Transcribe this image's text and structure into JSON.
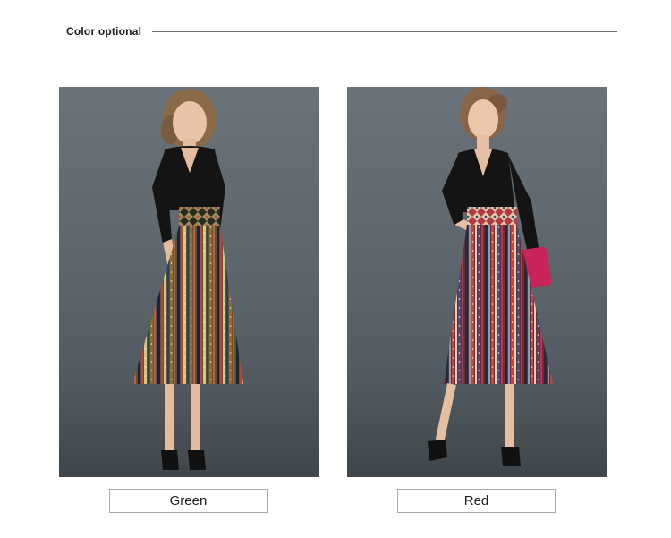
{
  "section": {
    "title": "Color optional"
  },
  "options": [
    {
      "label": "Green",
      "image": "model-wearing-green-pattern-dress"
    },
    {
      "label": "Red",
      "image": "model-wearing-red-pattern-dress"
    }
  ],
  "colors": {
    "backdrop": "#5c666c",
    "top": "#141414",
    "skirt_green": "#5d5a34",
    "skirt_red": "#8d2a34",
    "clutch": "#c8245a"
  }
}
